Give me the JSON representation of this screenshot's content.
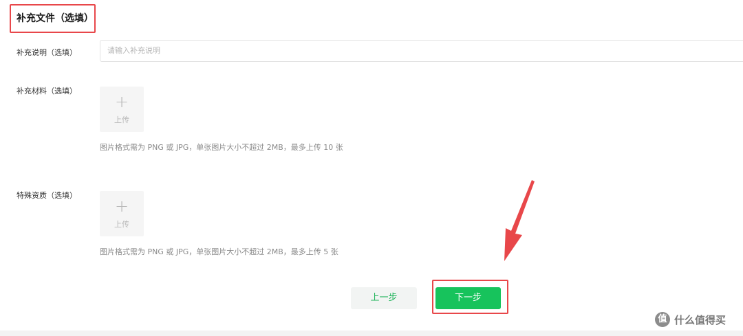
{
  "section_title": "补充文件（选填）",
  "fields": {
    "description": {
      "label": "补充说明（选填）",
      "placeholder": "请输入补充说明"
    },
    "materials": {
      "label": "补充材料（选填）",
      "upload_plus": "+",
      "upload_label": "上传",
      "hint": "图片格式需为 PNG 或 JPG，单张图片大小不超过 2MB，最多上传 10 张"
    },
    "qualifications": {
      "label": "特殊资质（选填）",
      "upload_plus": "+",
      "upload_label": "上传",
      "hint": "图片格式需为 PNG 或 JPG，单张图片大小不超过 2MB，最多上传 5 张"
    }
  },
  "buttons": {
    "prev_label": "上一步",
    "next_label": "下一步"
  },
  "watermark": {
    "logo": "值",
    "text": "什么值得买"
  },
  "colors": {
    "accent_green": "#17c35c",
    "annotation_red": "#e8474a"
  }
}
